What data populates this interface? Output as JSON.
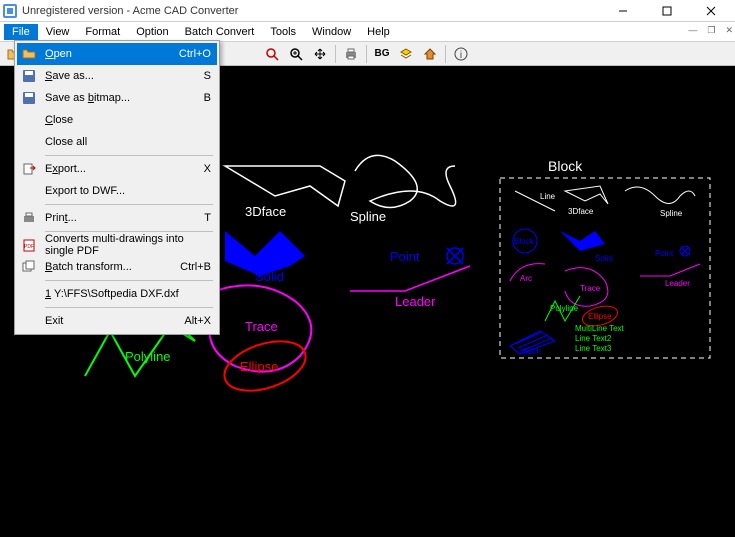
{
  "title": "Unregistered version - Acme CAD Converter",
  "menubar": [
    "File",
    "View",
    "Format",
    "Option",
    "Batch Convert",
    "Tools",
    "Window",
    "Help"
  ],
  "active_menu_index": 0,
  "dropdown": {
    "open": {
      "label": "Open",
      "shortcut": "Ctrl+O"
    },
    "saveas": {
      "label": "Save as..."
    },
    "savebitmap": {
      "label": "Save as bitmap..."
    },
    "savebitmap_shortcut": "B",
    "saveas_shortcut": "S",
    "close_one": {
      "label": "Close"
    },
    "close_all": {
      "label": "Close all"
    },
    "export_one": {
      "label": "Export..."
    },
    "export_shortcut": "X",
    "export_dwf": {
      "label": "Export to DWF..."
    },
    "print": {
      "label": "Print..."
    },
    "print_shortcut": "T",
    "convert_pdf": {
      "label": "Converts multi-drawings into single PDF"
    },
    "batch_transform": {
      "label": "Batch transform..."
    },
    "batch_shortcut": "Ctrl+B",
    "recent": {
      "label": "1 Y:\\FFS\\Softpedia DXF.dxf"
    },
    "exit": {
      "label": "Exit"
    },
    "exit_shortcut": "Alt+X"
  },
  "toolbar": {
    "bg_label": "BG"
  },
  "canvas_labels": {
    "block": "Block",
    "threedface": "3Dface",
    "spline": "Spline",
    "arc": "Arc",
    "point": "Point",
    "solid": "Solid",
    "leader": "Leader",
    "polyline": "Polyline",
    "trace": "Trace",
    "ellipse": "Ellipse",
    "mini_line": "Line",
    "mini_3dface": "3Dface",
    "mini_spline": "Spline",
    "mini_block": "Block",
    "mini_arc": "Arc",
    "mini_solid": "Solid",
    "mini_point": "Point",
    "mini_leader": "Leader",
    "mini_polyline": "Polyline",
    "mini_trace": "Trace",
    "mini_ellipse": "Ellipse",
    "mini_hatch": "Hatch",
    "multiline1": "MultiLine Text",
    "multiline2": "Line Text2",
    "multiline3": "Line Text3"
  }
}
